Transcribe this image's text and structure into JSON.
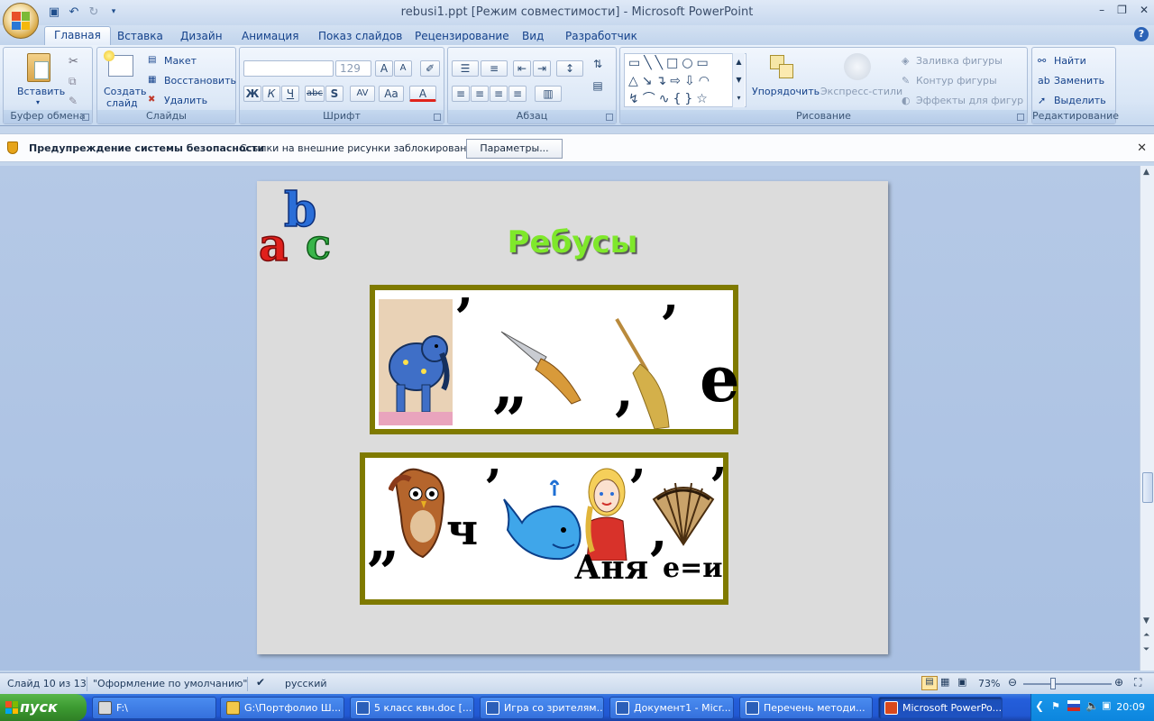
{
  "window": {
    "title": "rebusi1.ppt [Режим совместимости] - Microsoft PowerPoint"
  },
  "ribbon_tabs": [
    "Главная",
    "Вставка",
    "Дизайн",
    "Анимация",
    "Показ слайдов",
    "Рецензирование",
    "Вид",
    "Разработчик"
  ],
  "ribbon": {
    "clipboard": {
      "paste": "Вставить",
      "label": "Буфер обмена"
    },
    "slides": {
      "new_slide_1": "Создать",
      "new_slide_2": "слайд",
      "layout": "Макет",
      "reset": "Восстановить",
      "delete": "Удалить",
      "label": "Слайды"
    },
    "font": {
      "size": "129",
      "label": "Шрифт",
      "bold": "Ж",
      "italic": "К",
      "underline": "Ч",
      "strike": "abc",
      "shadow": "S",
      "spacing": "AV",
      "case": "Aa",
      "color": "A"
    },
    "paragraph": {
      "label": "Абзац"
    },
    "drawing": {
      "arrange": "Упорядочить",
      "quick_styles": "Экспресс-стили",
      "fill": "Заливка фигуры",
      "outline": "Контур фигуры",
      "effects": "Эффекты для фигур",
      "label": "Рисование"
    },
    "editing": {
      "find": "Найти",
      "replace": "Заменить",
      "select": "Выделить",
      "label": "Редактирование"
    }
  },
  "security_bar": {
    "title": "Предупреждение системы безопасности",
    "message": "Ссылки на внешние рисунки заблокированы",
    "button": "Параметры..."
  },
  "slide": {
    "title": "Ребусы",
    "rebus1": {
      "mark1": "’",
      "mark2": "„",
      "mark3": "’",
      "mark3b": ",",
      "letter": "е"
    },
    "rebus2": {
      "mark1": "„",
      "letter_ch": "ч",
      "mark2": "’",
      "mark3": "’",
      "name": "Аня",
      "mark4": "’",
      "mark5": ",",
      "rule": "е=и"
    }
  },
  "status": {
    "slide_counter": "Слайд 10 из 13",
    "theme": "\"Оформление по умолчанию\"",
    "language": "русский",
    "zoom": "73%"
  },
  "taskbar": {
    "start": "пуск",
    "tasks": [
      "F:\\",
      "G:\\Портфолио Ш...",
      "5 класс квн.doc [...",
      "Игра со зрителям...",
      "Документ1 - Micr...",
      "Перечень методи...",
      "Microsoft PowerPo..."
    ],
    "clock": "20:09"
  }
}
